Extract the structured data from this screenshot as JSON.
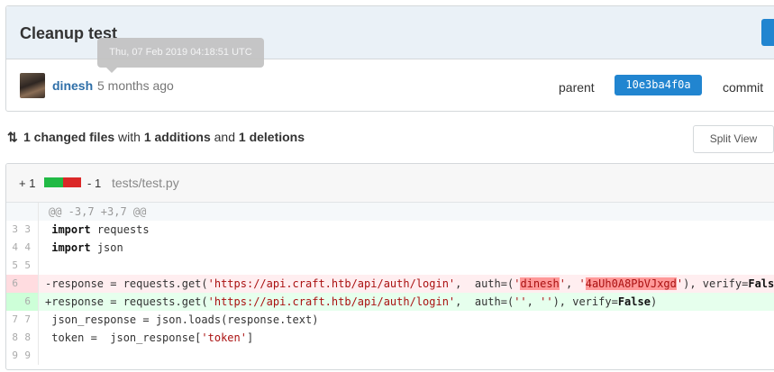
{
  "commit": {
    "title": "Cleanup test",
    "author": "dinesh",
    "time_ago": "5 months ago",
    "tooltip": "Thu, 07 Feb 2019 04:18:51 UTC",
    "parent_label": "parent",
    "parent_sha": "10e3ba4f0a",
    "commit_label": "commit"
  },
  "stats": {
    "changed": "1 changed files",
    "with": " with ",
    "additions": "1 additions",
    "and": " and ",
    "deletions": "1 deletions"
  },
  "split_view_label": "Split View",
  "file": {
    "additions": "+ 1",
    "deletions": "- 1",
    "path": "tests/test.py",
    "hunk_header": "@@ -3,7 +3,7 @@",
    "lines": [
      {
        "old": "3",
        "new": "3",
        "pre": " ",
        "kw": "import",
        "rest": " requests"
      },
      {
        "old": "4",
        "new": "4",
        "pre": " ",
        "kw": "import",
        "rest": " json"
      },
      {
        "old": "5",
        "new": "5",
        "text": ""
      },
      {
        "old": "6",
        "new": "",
        "a": "-response = requests.get(",
        "s1": "'https://api.craft.htb/api/auth/login'",
        "b": ",  auth=(",
        "s2a": "'",
        "s2h": "dinesh",
        "s2b": "'",
        "c": ", ",
        "s3a": "'",
        "s3h": "4aUh0A8PbVJxgd",
        "s3b": "'",
        "d": "), verify=",
        "kw": "False",
        "e": ")"
      },
      {
        "old": "",
        "new": "6",
        "a": "+response = requests.get(",
        "s1": "'https://api.craft.htb/api/auth/login'",
        "b": ",  auth=(",
        "s2": "''",
        "c": ", ",
        "s3": "''",
        "d": "), verify=",
        "kw": "False",
        "e": ")"
      },
      {
        "old": "7",
        "new": "7",
        "text": " json_response = json.loads(response.text)"
      },
      {
        "old": "8",
        "new": "8",
        "a": " token =  json_response[",
        "s": "'token'",
        "b": "]"
      },
      {
        "old": "9",
        "new": "9",
        "text": ""
      }
    ]
  }
}
